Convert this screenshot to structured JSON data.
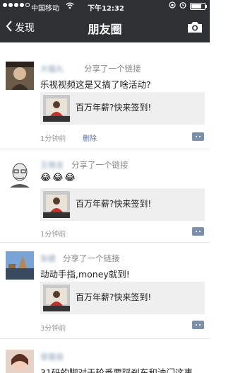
{
  "status_bar": {
    "carrier": "中国移动",
    "time": "下午12:32",
    "battery_level": 0.75
  },
  "nav": {
    "back_label": "发现",
    "title": "朋友圈"
  },
  "posts": [
    {
      "author": "大猫丸",
      "share_text": "分享了一个链接",
      "text": "乐视视频这是又搞了啥活动?",
      "link_title": "百万年薪?快来签到!",
      "time": "1分钟前",
      "delete_label": "删除"
    },
    {
      "author": "王晓龙",
      "share_text": "分享了一个链接",
      "emoji": [
        "😂",
        "😂",
        "😂"
      ],
      "link_title": "百万年薪?快来签到!",
      "time": "1分钟前"
    },
    {
      "author": "张健",
      "share_text": "分享了一个链接",
      "text": "动动手指,money就到!",
      "link_title": "百万年薪?快来签到!",
      "time": "3分钟前"
    },
    {
      "author": "邹喜丽",
      "text": "31码的脚对于轮番要踩刹车和油门这事"
    }
  ],
  "colors": {
    "nav_background": "#2e3134",
    "name_color": "#8a9bb5",
    "link_background": "#efefef",
    "comment_button": "#7c8fa8"
  },
  "icons": {
    "back": "chevron-left-icon",
    "camera": "camera-icon",
    "wifi": "wifi-icon",
    "comment": "comment-icon"
  }
}
